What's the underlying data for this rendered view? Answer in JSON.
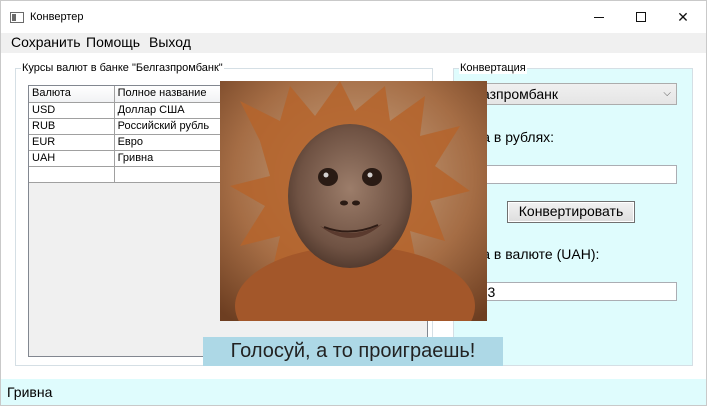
{
  "window": {
    "title": "Конвертер",
    "icon": "app-window-icon",
    "controls": {
      "minimize": "minimize-icon",
      "maximize": "maximize-icon",
      "close_glyph": "✕"
    }
  },
  "menu": {
    "items": [
      {
        "label": "Сохранить"
      },
      {
        "label": "Помощь"
      },
      {
        "label": "Выход"
      }
    ]
  },
  "rates_group": {
    "title": "Курсы валют в банке \"Белгазпромбанк\"",
    "columns": [
      "Валюта",
      "Полное название"
    ],
    "rows": [
      [
        "USD",
        "Доллар США"
      ],
      [
        "RUB",
        "Российский рубль"
      ],
      [
        "EUR",
        "Евро"
      ],
      [
        "UAH",
        "Гривна"
      ]
    ]
  },
  "conversion_group": {
    "title": "Конвертация",
    "bank_selected": "лгазпромбанк",
    "rub_label": "мма в рублях:",
    "rub_value": "0",
    "convert_button": "Конвертировать",
    "currency_label": "мма в валюте (UAH):",
    "currency_value": "3,33"
  },
  "overlay": {
    "photo": "orangutan-photo",
    "caption": "Голосуй, а то проиграешь!"
  },
  "statusbar": {
    "text": "Гривна"
  },
  "colors": {
    "panel_bg": "#dffcfd",
    "caption_bg": "#add8e6",
    "window_bg": "#f0f0f0"
  }
}
